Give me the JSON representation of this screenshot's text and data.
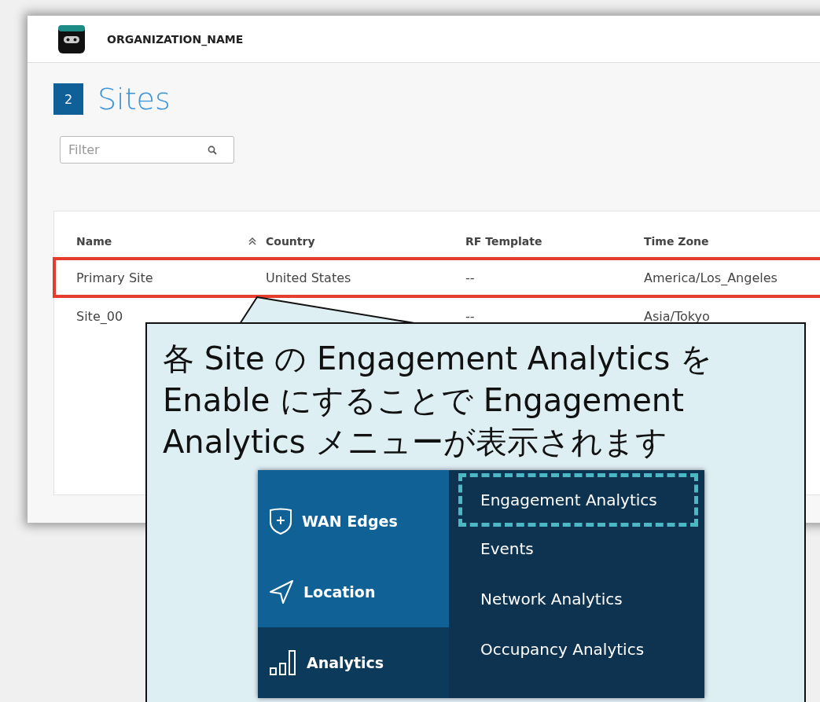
{
  "header": {
    "org_name": "ORGANIZATION_NAME"
  },
  "page": {
    "count": "2",
    "title": "Sites"
  },
  "filter": {
    "placeholder": "Filter"
  },
  "table": {
    "columns": [
      {
        "label": "Name",
        "sorted": true
      },
      {
        "label": "Country",
        "sorted": false
      },
      {
        "label": "RF Template",
        "sorted": false
      },
      {
        "label": "Time Zone",
        "sorted": false
      }
    ],
    "rows": [
      {
        "cells": [
          "Primary Site",
          "United States",
          "--",
          "America/Los_Angeles"
        ],
        "highlighted": true
      },
      {
        "cells": [
          "Site_00",
          "",
          "--",
          "Asia/Tokyo"
        ],
        "highlighted": false
      }
    ]
  },
  "callout": {
    "text": "各 Site の Engagement Analytics を Enable にすることで Engagement Analytics メニューが表示されます"
  },
  "menu": {
    "sidebar": [
      {
        "label": "WAN Edges",
        "kind": "shield",
        "selected": false
      },
      {
        "label": "Location",
        "kind": "location",
        "selected": false
      },
      {
        "label": "Analytics",
        "kind": "bars",
        "selected": true
      }
    ],
    "submenu": [
      {
        "label": "Engagement Analytics",
        "highlighted": true
      },
      {
        "label": "Events",
        "highlighted": false
      },
      {
        "label": "Network Analytics",
        "highlighted": false
      },
      {
        "label": "Occupancy Analytics",
        "highlighted": false
      }
    ]
  }
}
